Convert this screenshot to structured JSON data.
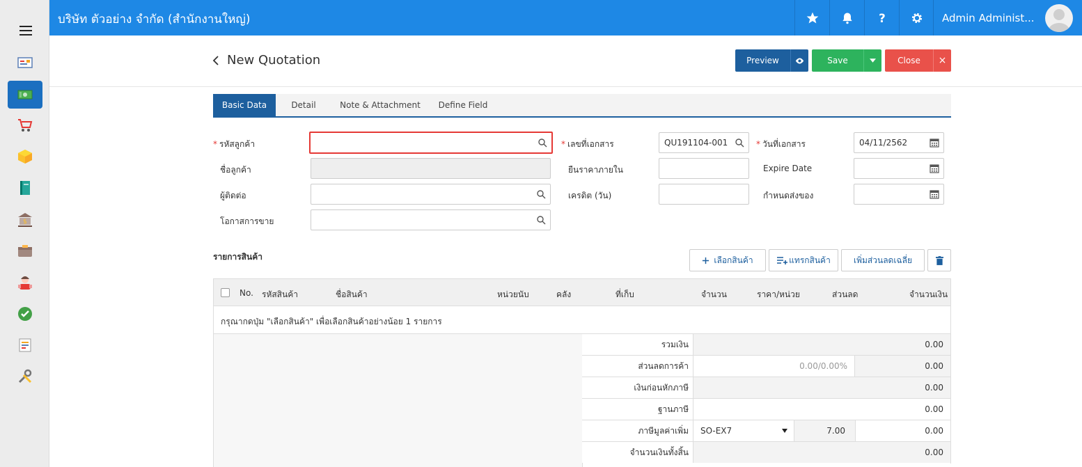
{
  "app": {
    "company": "บริษัท ตัวอย่าง จำกัด (สำนักงานใหญ่)",
    "user": "Admin Administ..."
  },
  "sidebar": {
    "items": [
      {
        "name": "dashboard-icon"
      },
      {
        "name": "money-icon",
        "active": true
      },
      {
        "name": "cart-icon"
      },
      {
        "name": "box-icon"
      },
      {
        "name": "book-icon"
      },
      {
        "name": "bank-icon"
      },
      {
        "name": "wallet-icon"
      },
      {
        "name": "people-icon"
      },
      {
        "name": "check-icon"
      },
      {
        "name": "document-icon"
      },
      {
        "name": "tools-icon"
      }
    ]
  },
  "header": {
    "title": "New Quotation",
    "preview_label": "Preview",
    "save_label": "Save",
    "close_label": "Close",
    "close_x": "×"
  },
  "tabs": [
    "Basic Data",
    "Detail",
    "Note & Attachment",
    "Define Field"
  ],
  "form": {
    "customer_code_label": "รหัสลูกค้า",
    "customer_code_value": "",
    "customer_name_label": "ชื่อลูกค้า",
    "contact_label": "ผู้ติดต่อ",
    "opportunity_label": "โอกาสการขาย",
    "doc_no_label": "เลขที่เอกสาร",
    "doc_no_value": "QU191104-001",
    "price_valid_label": "ยืนราคาภายใน",
    "credit_label": "เครดิต (วัน)",
    "doc_date_label": "วันที่เอกสาร",
    "doc_date_value": "04/11/2562",
    "expire_label": "Expire Date",
    "delivery_label": "กำหนดส่งของ"
  },
  "products": {
    "title": "รายการสินค้า",
    "select_label": "เลือกสินค้า",
    "insert_label": "แทรกสินค้า",
    "avg_discount_label": "เพิ่มส่วนลดเฉลี่ย",
    "columns": [
      "No.",
      "รหัสสินค้า",
      "ชื่อสินค้า",
      "หน่วยนับ",
      "คลัง",
      "ที่เก็บ",
      "จำนวน",
      "ราคา/หน่วย",
      "ส่วนลด",
      "จำนวนเงิน"
    ],
    "empty_message": "กรุณากดปุ่ม \"เลือกสินค้า\" เพื่อเลือกสินค้าอย่างน้อย 1 รายการ"
  },
  "summary": {
    "subtotal_label": "รวมเงิน",
    "subtotal": "0.00",
    "trade_discount_label": "ส่วนลดการค้า",
    "trade_discount_input": "0.00/0.00%",
    "trade_discount": "0.00",
    "before_tax_label": "เงินก่อนหักภาษี",
    "before_tax": "0.00",
    "tax_base_label": "ฐานภาษี",
    "tax_base": "0.00",
    "vat_label": "ภาษีมูลค่าเพิ่ม",
    "vat_code": "SO-EX7",
    "vat_rate": "7.00",
    "vat_amount": "0.00",
    "grand_total_label": "จำนวนเงินทั้งสิ้น",
    "grand_total": "0.00"
  }
}
